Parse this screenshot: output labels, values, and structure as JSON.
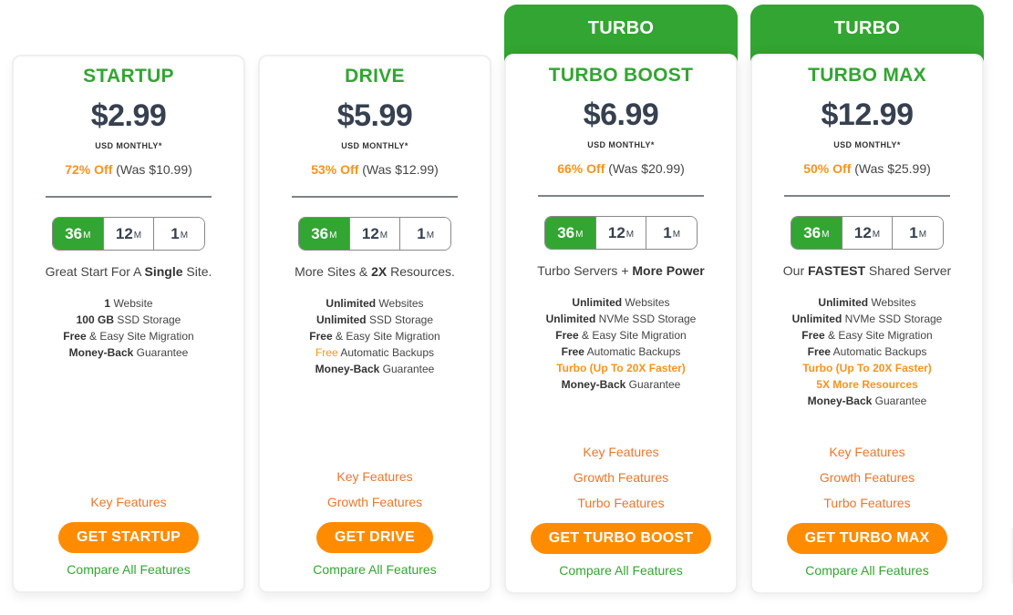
{
  "colors": {
    "brand_green": "#33a532",
    "accent_orange": "#ff8c00",
    "discount_orange": "#f7931e",
    "link_orange": "#e8772e",
    "price_dark": "#36404f"
  },
  "plans": [
    {
      "name": "STARTUP",
      "ribbon": null,
      "price": "$2.99",
      "term": "USD MONTHLY*",
      "discount_pct": "72% Off",
      "was": "(Was $10.99)",
      "terms": [
        {
          "num": "36",
          "unit": "M",
          "active": true
        },
        {
          "num": "12",
          "unit": "M",
          "active": false
        },
        {
          "num": "1",
          "unit": "M",
          "active": false
        }
      ],
      "tagline": {
        "pre": "Great Start For A ",
        "bold": "Single",
        "post": " Site."
      },
      "features": [
        {
          "bold": "1",
          "rest": " Website",
          "style": "normal"
        },
        {
          "bold": "100 GB",
          "rest": " SSD Storage",
          "style": "normal"
        },
        {
          "bold": "Free",
          "rest": " & Easy Site Migration",
          "style": "normal"
        },
        {
          "bold": "Money-Back",
          "rest": " Guarantee",
          "style": "normal"
        }
      ],
      "feature_links": [
        "Key Features"
      ],
      "cta": "GET STARTUP",
      "compare": "Compare All Features"
    },
    {
      "name": "DRIVE",
      "ribbon": null,
      "price": "$5.99",
      "term": "USD MONTHLY*",
      "discount_pct": "53% Off",
      "was": "(Was $12.99)",
      "terms": [
        {
          "num": "36",
          "unit": "M",
          "active": true
        },
        {
          "num": "12",
          "unit": "M",
          "active": false
        },
        {
          "num": "1",
          "unit": "M",
          "active": false
        }
      ],
      "tagline": {
        "pre": "More Sites & ",
        "bold": "2X",
        "post": " Resources."
      },
      "features": [
        {
          "bold": "Unlimited",
          "rest": " Websites",
          "style": "normal"
        },
        {
          "bold": "Unlimited",
          "rest": " SSD Storage",
          "style": "normal"
        },
        {
          "bold": "Free",
          "rest": " & Easy Site Migration",
          "style": "normal"
        },
        {
          "bold": "Free",
          "rest": " Automatic Backups",
          "style": "orange-lead"
        },
        {
          "bold": "Money-Back",
          "rest": " Guarantee",
          "style": "normal"
        }
      ],
      "feature_links": [
        "Key Features",
        "Growth Features"
      ],
      "cta": "GET DRIVE",
      "compare": "Compare All Features"
    },
    {
      "name": "TURBO BOOST",
      "ribbon": "TURBO",
      "price": "$6.99",
      "term": "USD MONTHLY*",
      "discount_pct": "66% Off",
      "was": "(Was $20.99)",
      "terms": [
        {
          "num": "36",
          "unit": "M",
          "active": true
        },
        {
          "num": "12",
          "unit": "M",
          "active": false
        },
        {
          "num": "1",
          "unit": "M",
          "active": false
        }
      ],
      "tagline": {
        "pre": "Turbo Servers + ",
        "bold": "More Power",
        "post": ""
      },
      "features": [
        {
          "bold": "Unlimited",
          "rest": " Websites",
          "style": "normal"
        },
        {
          "bold": "Unlimited",
          "rest": " NVMe SSD Storage",
          "style": "normal"
        },
        {
          "bold": "Free",
          "rest": " & Easy Site Migration",
          "style": "normal"
        },
        {
          "bold": "Free",
          "rest": " Automatic Backups",
          "style": "normal"
        },
        {
          "bold": "Turbo (Up To 20X Faster)",
          "rest": "",
          "style": "orange-bold"
        },
        {
          "bold": "Money-Back",
          "rest": " Guarantee",
          "style": "normal"
        }
      ],
      "feature_links": [
        "Key Features",
        "Growth Features",
        "Turbo Features"
      ],
      "cta": "GET TURBO BOOST",
      "compare": "Compare All Features"
    },
    {
      "name": "TURBO MAX",
      "ribbon": "TURBO",
      "price": "$12.99",
      "term": "USD MONTHLY*",
      "discount_pct": "50% Off",
      "was": "(Was $25.99)",
      "terms": [
        {
          "num": "36",
          "unit": "M",
          "active": true
        },
        {
          "num": "12",
          "unit": "M",
          "active": false
        },
        {
          "num": "1",
          "unit": "M",
          "active": false
        }
      ],
      "tagline": {
        "pre": "Our ",
        "bold": "FASTEST",
        "post": " Shared Server"
      },
      "features": [
        {
          "bold": "Unlimited",
          "rest": " Websites",
          "style": "normal"
        },
        {
          "bold": "Unlimited",
          "rest": " NVMe SSD Storage",
          "style": "normal"
        },
        {
          "bold": "Free",
          "rest": " & Easy Site Migration",
          "style": "normal"
        },
        {
          "bold": "Free",
          "rest": " Automatic Backups",
          "style": "normal"
        },
        {
          "bold": "Turbo (Up To 20X Faster)",
          "rest": "",
          "style": "orange-bold"
        },
        {
          "bold": "5X More Resources",
          "rest": "",
          "style": "orange-bold"
        },
        {
          "bold": "Money-Back",
          "rest": " Guarantee",
          "style": "normal"
        }
      ],
      "feature_links": [
        "Key Features",
        "Growth Features",
        "Turbo Features"
      ],
      "cta": "GET TURBO MAX",
      "compare": "Compare All Features"
    }
  ]
}
